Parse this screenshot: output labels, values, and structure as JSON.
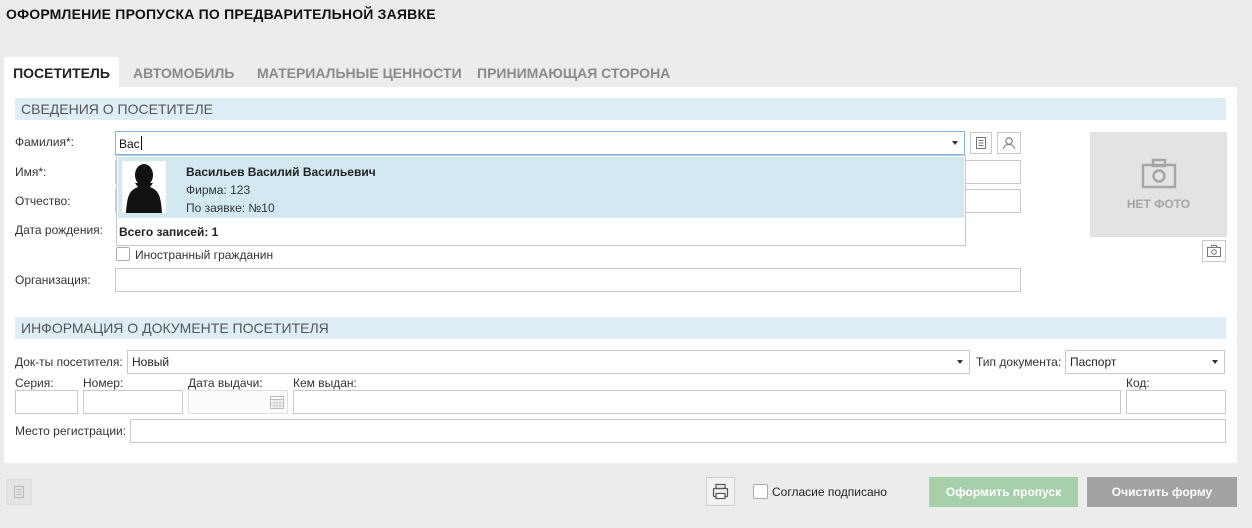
{
  "page_title": "ОФОРМЛЕНИЕ ПРОПУСКА ПО ПРЕДВАРИТЕЛЬНОЙ ЗАЯВКЕ",
  "tabs": [
    {
      "label": "ПОСЕТИТЕЛЬ",
      "active": true
    },
    {
      "label": "АВТОМОБИЛЬ",
      "active": false
    },
    {
      "label": "МАТЕРИАЛЬНЫЕ ЦЕННОСТИ",
      "active": false
    },
    {
      "label": "ПРИНИМАЮЩАЯ СТОРОНА",
      "active": false
    }
  ],
  "visitor": {
    "section_title": "СВЕДЕНИЯ О ПОСЕТИТЕЛЕ",
    "surname_label": "Фамилия*:",
    "surname_value": "Вас",
    "name_label": "Имя*:",
    "patronymic_label": "Отчество:",
    "birthdate_label": "Дата рождения:",
    "foreign_label": "Иностранный гражданин",
    "organization_label": "Организация:",
    "no_photo": "НЕТ ФОТО"
  },
  "suggestions": {
    "items": [
      {
        "name": "Васильев Василий Васильевич",
        "firm": "Фирма: 123",
        "request": "По заявке: №10"
      }
    ],
    "total": "Всего записей: 1"
  },
  "document": {
    "section_title": "ИНФОРМАЦИЯ О ДОКУМЕНТЕ ПОСЕТИТЕЛЯ",
    "docs_label": "Док-ты посетителя:",
    "docs_value": "Новый",
    "doc_type_label": "Тип документа:",
    "doc_type_value": "Паспорт",
    "series_label": "Серия:",
    "number_label": "Номер:",
    "issue_date_label": "Дата выдачи:",
    "issued_by_label": "Кем выдан:",
    "code_label": "Код:",
    "registration_label": "Место регистрации:"
  },
  "footer": {
    "consent_label": "Согласие подписано",
    "issue_button": "Оформить пропуск",
    "clear_button": "Очистить форму"
  },
  "colors": {
    "section_bg": "#deeef6",
    "suggestion_bg": "#d3e9f1",
    "issue_button": "#a7cfa9",
    "clear_button": "#a3a3a3"
  }
}
